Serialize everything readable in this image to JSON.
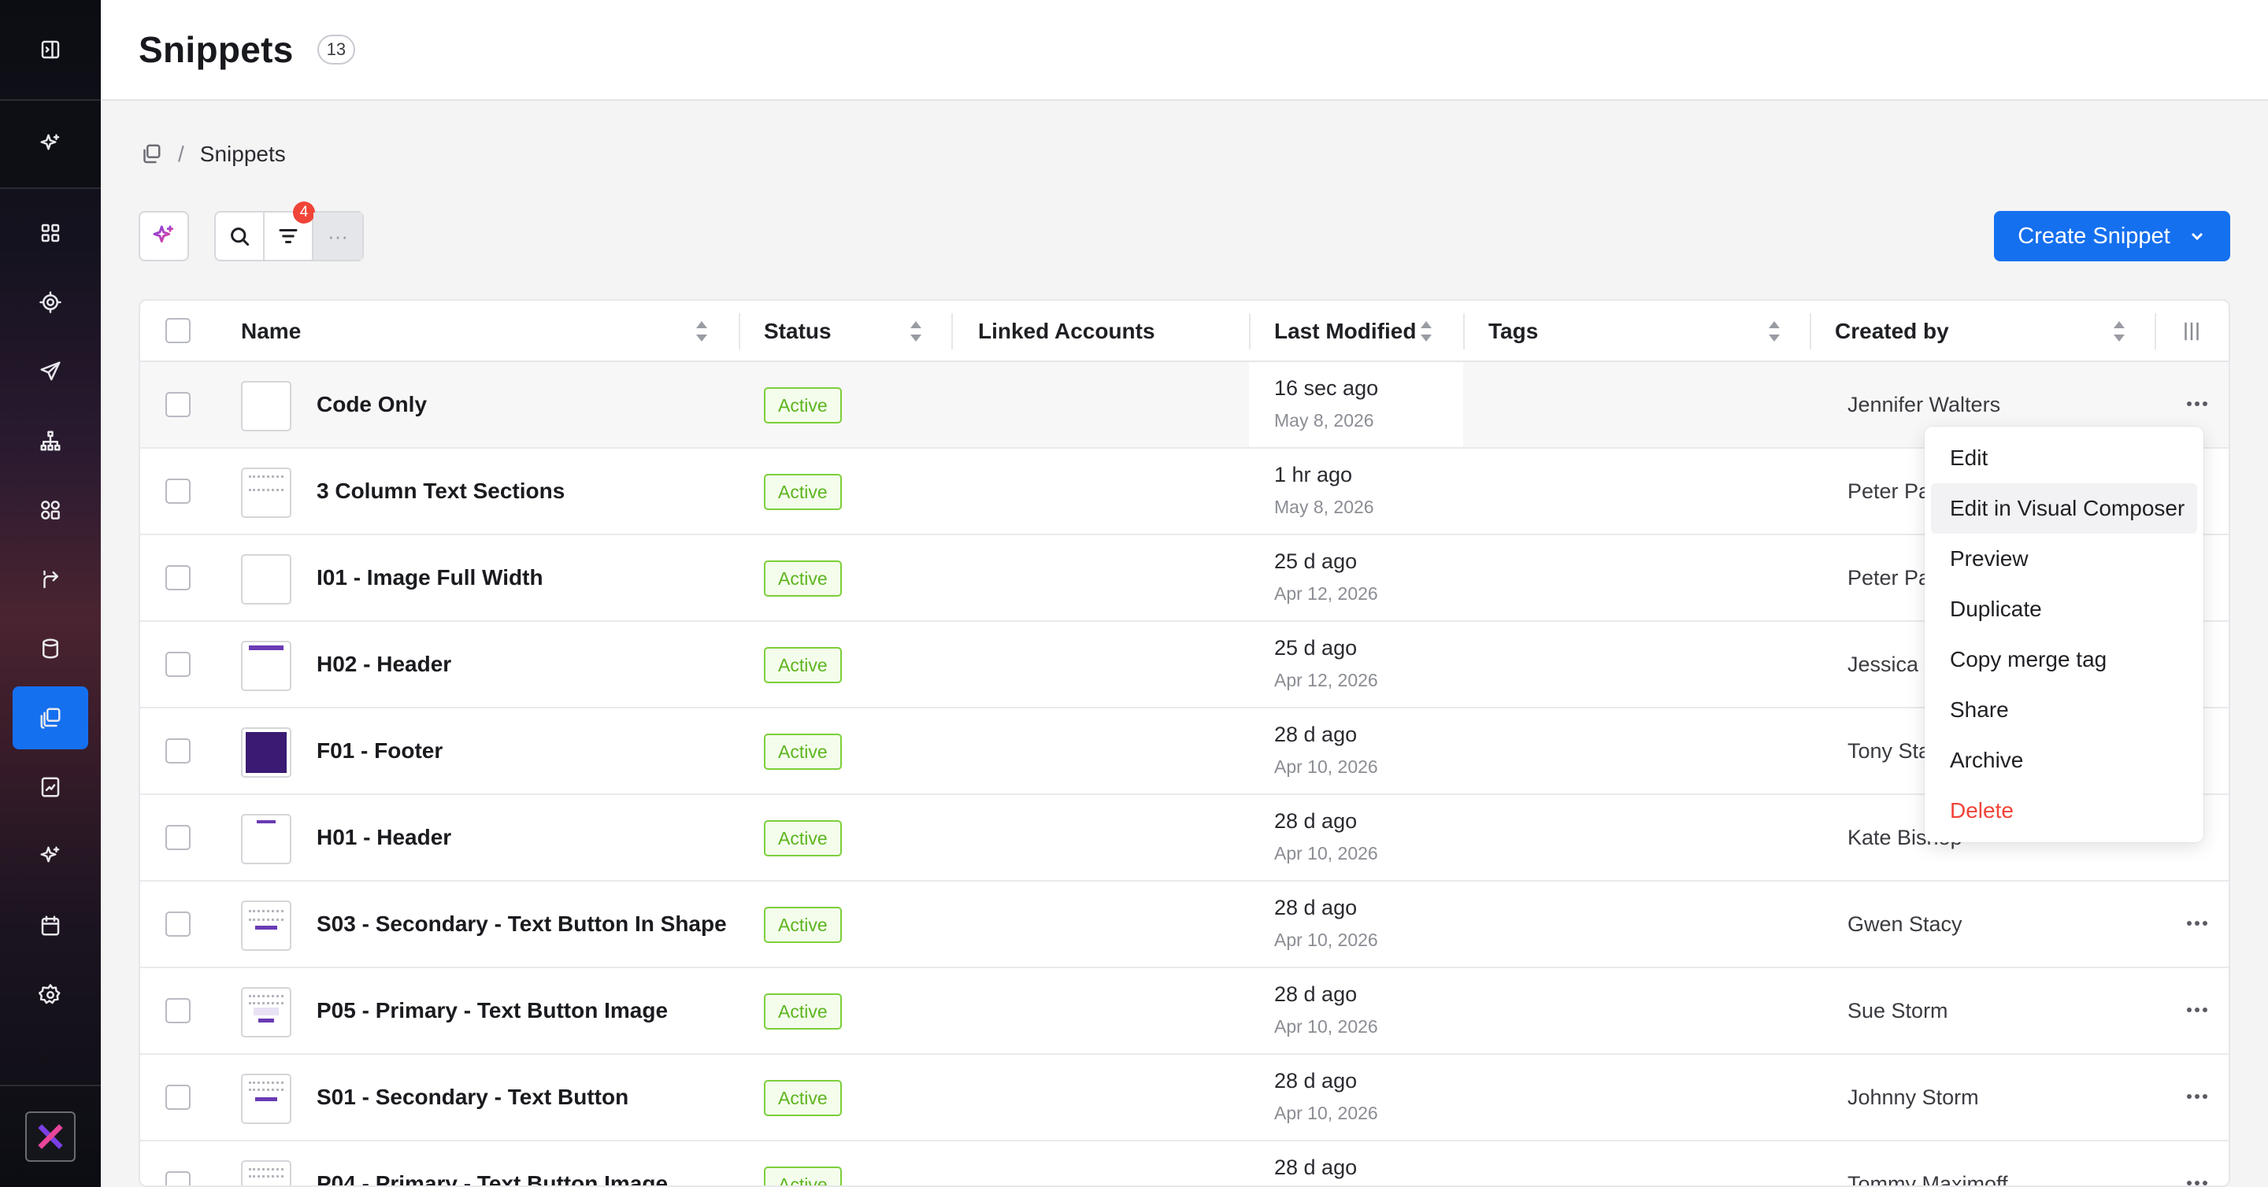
{
  "header": {
    "title": "Snippets",
    "count": "13"
  },
  "breadcrumb": {
    "current": "Snippets"
  },
  "toolbar": {
    "filter_count": "4",
    "more": "···",
    "create_label": "Create Snippet"
  },
  "table": {
    "columns": {
      "name": "Name",
      "status": "Status",
      "linked": "Linked Accounts",
      "modified": "Last Modified",
      "tags": "Tags",
      "created": "Created by"
    },
    "rows": [
      {
        "name": "Code Only",
        "status": "Active",
        "modified": "16 sec ago",
        "date": "May 8, 2026",
        "created_by": "Jennifer Walters"
      },
      {
        "name": "3 Column Text Sections",
        "status": "Active",
        "modified": "1 hr ago",
        "date": "May 8, 2026",
        "created_by": "Peter Pa"
      },
      {
        "name": "I01 - Image Full Width",
        "status": "Active",
        "modified": "25 d ago",
        "date": "Apr 12, 2026",
        "created_by": "Peter Pa"
      },
      {
        "name": "H02 - Header",
        "status": "Active",
        "modified": "25 d ago",
        "date": "Apr 12, 2026",
        "created_by": "Jessica J"
      },
      {
        "name": "F01 - Footer",
        "status": "Active",
        "modified": "28 d ago",
        "date": "Apr 10, 2026",
        "created_by": "Tony Sta"
      },
      {
        "name": "H01 - Header",
        "status": "Active",
        "modified": "28 d ago",
        "date": "Apr 10, 2026",
        "created_by": "Kate Bishop"
      },
      {
        "name": "S03 - Secondary - Text Button In Shape",
        "status": "Active",
        "modified": "28 d ago",
        "date": "Apr 10, 2026",
        "created_by": "Gwen Stacy"
      },
      {
        "name": "P05 - Primary - Text Button Image",
        "status": "Active",
        "modified": "28 d ago",
        "date": "Apr 10, 2026",
        "created_by": "Sue Storm"
      },
      {
        "name": "S01 - Secondary - Text Button",
        "status": "Active",
        "modified": "28 d ago",
        "date": "Apr 10, 2026",
        "created_by": "Johnny Storm"
      },
      {
        "name": "P04 - Primary - Text Button Image",
        "status": "Active",
        "modified": "28 d ago",
        "date": "",
        "created_by": "Tommy Maximoff"
      }
    ]
  },
  "menu": {
    "items": [
      "Edit",
      "Edit in Visual Composer",
      "Preview",
      "Duplicate",
      "Copy merge tag",
      "Share",
      "Archive",
      "Delete"
    ]
  },
  "colors": {
    "accent": "#1570ef",
    "danger": "#f04438",
    "active_green": "#5db51f"
  }
}
